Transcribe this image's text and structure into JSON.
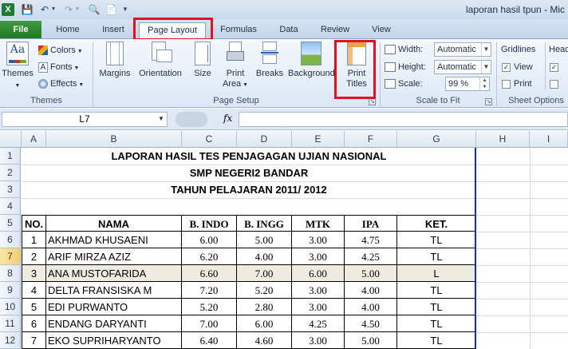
{
  "window": {
    "title": "laporan hasil tpun - Mic"
  },
  "tabs": [
    "File",
    "Home",
    "Insert",
    "Page Layout",
    "Formulas",
    "Data",
    "Review",
    "View"
  ],
  "ribbon": {
    "themes": {
      "themes_label": "Themes",
      "colors": "Colors",
      "fonts": "Fonts",
      "effects": "Effects",
      "group": "Themes"
    },
    "page_setup": {
      "margins": "Margins",
      "orientation": "Orientation",
      "size": "Size",
      "print_area_1": "Print",
      "print_area_2": "Area",
      "breaks": "Breaks",
      "background": "Background",
      "print_titles_1": "Print",
      "print_titles_2": "Titles",
      "group": "Page Setup"
    },
    "scale": {
      "width_label": "Width:",
      "width_value": "Automatic",
      "height_label": "Height:",
      "height_value": "Automatic",
      "scale_label": "Scale:",
      "scale_value": "99 %",
      "group": "Scale to Fit"
    },
    "sheet_options": {
      "gridlines": "Gridlines",
      "view": "View",
      "print": "Print",
      "headings": "Head",
      "group": "Sheet Options"
    }
  },
  "formula_bar": {
    "name_box": "L7",
    "fx": "fx",
    "value": ""
  },
  "columns": [
    "A",
    "B",
    "C",
    "D",
    "E",
    "F",
    "G",
    "H",
    "I"
  ],
  "rows": [
    "1",
    "2",
    "3",
    "4",
    "5",
    "6",
    "7",
    "8",
    "9",
    "10",
    "11",
    "12"
  ],
  "sheet": {
    "title1": "LAPORAN HASIL TES PENJAGAGAN UJIAN NASIONAL",
    "title2": "SMP NEGERI2 BANDAR",
    "title3": "TAHUN PELAJARAN 2011/ 2012",
    "headers": [
      "NO.",
      "NAMA",
      "B. INDO",
      "B. INGG",
      "MTK",
      "IPA",
      "KET."
    ],
    "data": [
      [
        "1",
        "AKHMAD KHUSAENI",
        "6.00",
        "5.00",
        "3.00",
        "4.75",
        "TL"
      ],
      [
        "2",
        "ARIF MIRZA AZIZ",
        "6.20",
        "4.00",
        "3.00",
        "4.25",
        "TL"
      ],
      [
        "3",
        "ANA MUSTOFARIDA",
        "6.60",
        "7.00",
        "6.00",
        "5.00",
        "L"
      ],
      [
        "4",
        "DELTA FRANSISKA M",
        "7.20",
        "5.20",
        "3.00",
        "4.00",
        "TL"
      ],
      [
        "5",
        "EDI PURWANTO",
        "5.20",
        "2.80",
        "3.00",
        "4.00",
        "TL"
      ],
      [
        "6",
        "ENDANG DARYANTI",
        "7.00",
        "6.00",
        "4.25",
        "4.50",
        "TL"
      ],
      [
        "7",
        "EKO SUPRIHARYANTO",
        "6.40",
        "4.60",
        "3.00",
        "5.00",
        "TL"
      ]
    ]
  },
  "colors": {
    "file_tab": "#2a8a2e",
    "highlight_box": "#e0121d",
    "selected_row": "#eeece1",
    "print_border": "#1a24c8"
  }
}
